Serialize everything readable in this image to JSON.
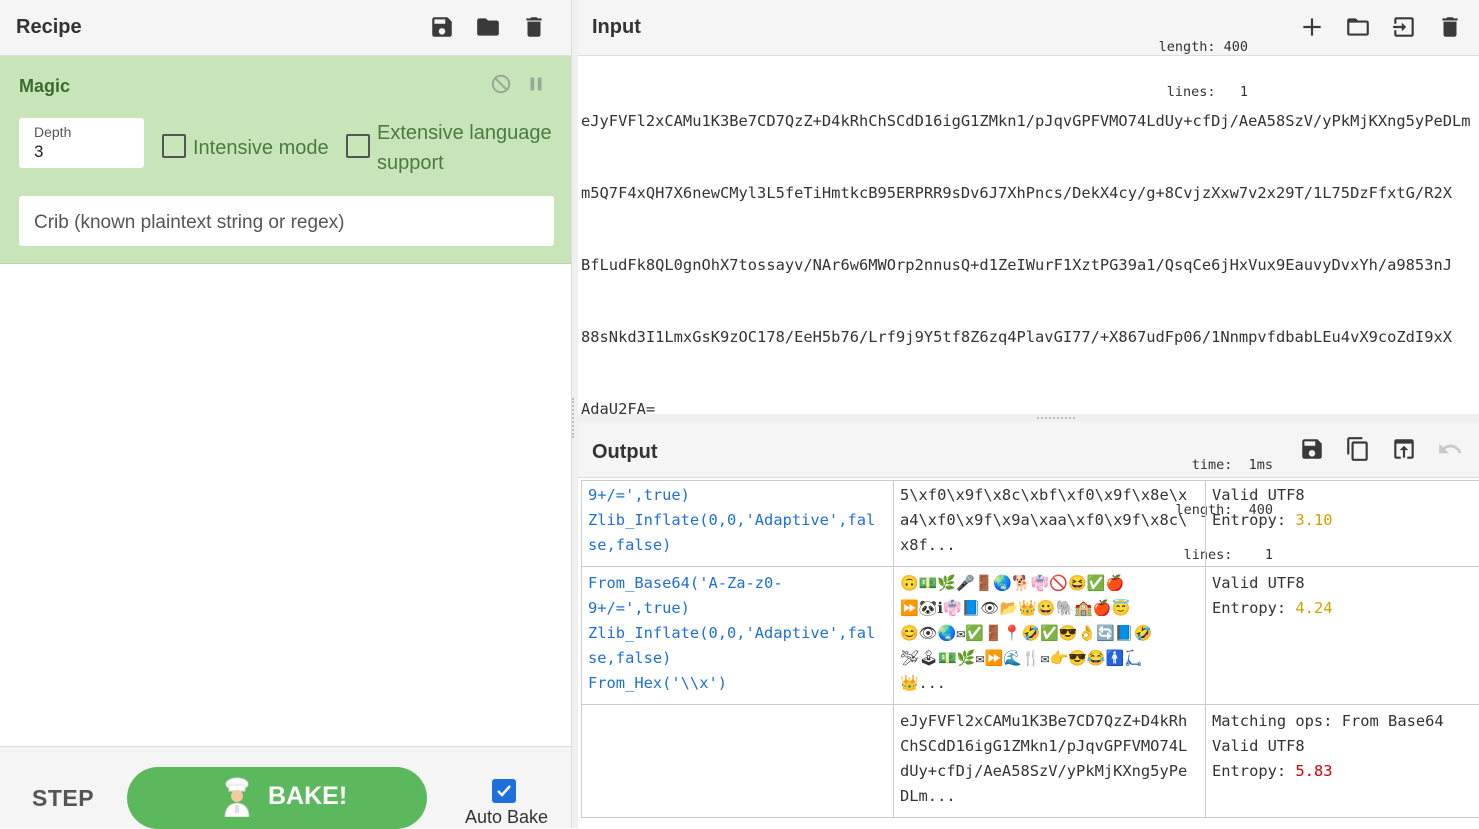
{
  "recipe": {
    "title": "Recipe",
    "icons": [
      "save-icon",
      "folder-icon",
      "trash-icon"
    ]
  },
  "magic": {
    "title": "Magic",
    "depth_label": "Depth",
    "depth_value": "3",
    "intensive_label": "Intensive mode",
    "intensive_checked": false,
    "extensive_label_1": "Extensive language",
    "extensive_label_2": "support",
    "extensive_checked": false,
    "crib_placeholder": "Crib (known plaintext string or regex)"
  },
  "controls": {
    "step_label": "STEP",
    "bake_label": "BAKE!",
    "autobake_label": "Auto Bake",
    "autobake_checked": true
  },
  "input": {
    "title": "Input",
    "stats_length": "length: 400",
    "stats_lines": " lines:   1",
    "lines": [
      "eJyFVFl2xCAMu1K3Be7CD7QzZ+D4kRhChSCdD16igG1ZMkn1/pJqvGPFVMO74LdUy+cfDj/AeA58SzV/yPkMjKXng5yPeDLm",
      "m5Q7F4xQH7X6newCMyl3L5feTiHmtkcB95ERPRR9sDv6J7XhPncs/DekX4cy/g+8CvjzXxw7v2x29T/1L75DzFfxtG/R2X",
      "BfLudFk8QL0gnOhX7tossayv/NAr6w6MWOrp2nnusQ+d1ZeIWurF1XztPG39a1/QsqCe6jHxVux9EauvyDvxYh/a9853nJ",
      "88sNkd3I1LmxGsK9zOC178/EeH5b76/Lrf9j9Y5tf8Z6zq4PlavGI77/+X867udFp06/1NnmpvfdbabLEu4vX9coZdI9xX",
      "AdaU2FA="
    ]
  },
  "output": {
    "title": "Output",
    "stats_time": "time:  1ms",
    "stats_length": "length:  400",
    "stats_lines": "lines:    1",
    "rows": [
      {
        "ops": [
          "9+/=',true)",
          "Zlib_Inflate(0,0,'Adaptive',fal",
          "se,false)"
        ],
        "result": [
          "5\\xf0\\x9f\\x8c\\xbf\\xf0\\x9f\\x8e\\x",
          "a4\\xf0\\x9f\\x9a\\xaa\\xf0\\x9f\\x8c\\",
          "x8f..."
        ],
        "props": [
          "Valid UTF8"
        ],
        "entropy_label": "Entropy: ",
        "entropy": "3.10",
        "entropy_color": "#d39e00"
      },
      {
        "ops": [
          "From_Base64('A-Za-z0-",
          "9+/=',true)",
          "Zlib_Inflate(0,0,'Adaptive',fal",
          "se,false)",
          "From_Hex('\\\\x')"
        ],
        "result": [
          "🙃💵🌿🎤🚪🌏🐕👘🚫😆✅🍎",
          "⏩🐼ℹ👘📘👁📂👑😀🐘🏫🍎😇",
          "😊👁🌏✉✅🚪📍🤣✅😎👌🔄📘🤣",
          "🛩🕹💵🌿✉⏩🌊🍴✉👉😎😂🚹🛴",
          "👑..."
        ],
        "props": [
          "Valid UTF8"
        ],
        "entropy_label": "Entropy: ",
        "entropy": "4.24",
        "entropy_color": "#d39e00"
      },
      {
        "ops": [],
        "result": [
          "eJyFVFl2xCAMu1K3Be7CD7QzZ+D4kRh",
          "ChSCdD16igG1ZMkn1/pJqvGPFVMO74L",
          "dUy+cfDj/AeA58SzV/yPkMjKXng5yPe",
          "DLm..."
        ],
        "props": [
          "Matching ops: From Base64",
          "Valid UTF8"
        ],
        "entropy_label": "Entropy: ",
        "entropy": "5.83",
        "entropy_color": "#cc0000"
      }
    ]
  }
}
